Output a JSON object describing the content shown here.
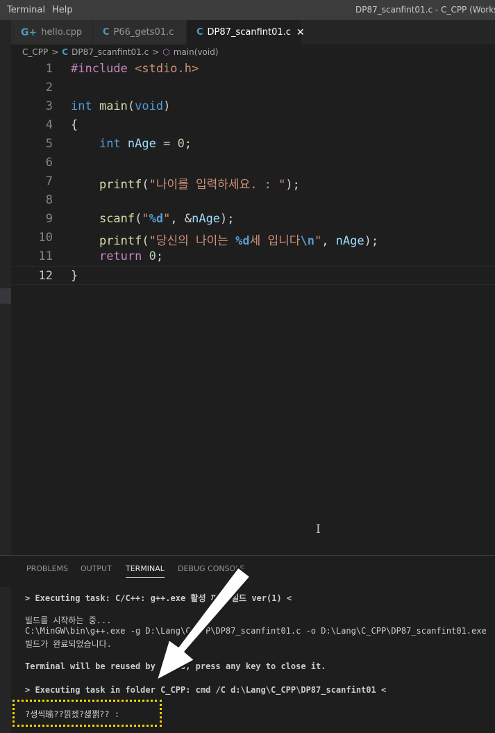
{
  "menu": [
    "Terminal",
    "Help"
  ],
  "window_title": "DP87_scanfint01.c - C_CPP (Workspace",
  "tabs": [
    {
      "label": "hello.cpp",
      "icon": "cpp-file-icon",
      "glyph": "G+"
    },
    {
      "label": "P66_gets01.c",
      "icon": "c-file-icon",
      "glyph": "C"
    },
    {
      "label": "DP87_scanfint01.c",
      "icon": "c-file-icon",
      "glyph": "C",
      "close": "✕"
    }
  ],
  "breadcrumb": {
    "folder": "C_CPP",
    "sep": ">",
    "file_glyph": "C",
    "file": "DP87_scanfint01.c",
    "symbol_glyph": "⬡",
    "symbol": "main(void)"
  },
  "code_lines": [
    {
      "n": "1",
      "html_parts": [
        [
          "kw-pre",
          "#include "
        ],
        [
          "str",
          "<stdio.h>"
        ]
      ]
    },
    {
      "n": "2",
      "html_parts": []
    },
    {
      "n": "3",
      "html_parts": [
        [
          "kw",
          "int "
        ],
        [
          "fn",
          "main"
        ],
        [
          "",
          "("
        ],
        [
          "kw",
          "void"
        ],
        [
          "",
          ")"
        ]
      ]
    },
    {
      "n": "4",
      "html_parts": [
        [
          "",
          "{"
        ]
      ]
    },
    {
      "n": "5",
      "html_parts": [
        [
          "",
          "    "
        ],
        [
          "kw",
          "int "
        ],
        [
          "var",
          "nAge"
        ],
        [
          "",
          " = "
        ],
        [
          "num",
          "0"
        ],
        [
          "",
          ";"
        ]
      ]
    },
    {
      "n": "6",
      "html_parts": []
    },
    {
      "n": "7",
      "html_parts": [
        [
          "",
          "    "
        ],
        [
          "fn",
          "printf"
        ],
        [
          "",
          "("
        ],
        [
          "str",
          "\"나이를 입력하세요. : \""
        ],
        [
          "",
          ");"
        ]
      ]
    },
    {
      "n": "8",
      "html_parts": []
    },
    {
      "n": "9",
      "html_parts": [
        [
          "",
          "    "
        ],
        [
          "fn",
          "scanf"
        ],
        [
          "",
          "("
        ],
        [
          "str",
          "\""
        ],
        [
          "esc",
          "%d"
        ],
        [
          "str",
          "\""
        ],
        [
          "",
          ", &"
        ],
        [
          "var",
          "nAge"
        ],
        [
          "",
          ");"
        ]
      ]
    },
    {
      "n": "10",
      "html_parts": [
        [
          "",
          "    "
        ],
        [
          "fn",
          "printf"
        ],
        [
          "",
          "("
        ],
        [
          "str",
          "\"당신의 나이는 "
        ],
        [
          "esc",
          "%d"
        ],
        [
          "str",
          "세 입니다"
        ],
        [
          "esc",
          "\\n"
        ],
        [
          "str",
          "\""
        ],
        [
          "",
          ", "
        ],
        [
          "var",
          "nAge"
        ],
        [
          "",
          ");"
        ]
      ]
    },
    {
      "n": "11",
      "html_parts": [
        [
          "",
          "    "
        ],
        [
          "ctrl",
          "return "
        ],
        [
          "num",
          "0"
        ],
        [
          "",
          ";"
        ]
      ]
    },
    {
      "n": "12",
      "html_parts": [
        [
          "",
          "}"
        ]
      ]
    }
  ],
  "panel_tabs": [
    "PROBLEMS",
    "OUTPUT",
    "TERMINAL",
    "DEBUG CONSOLE"
  ],
  "terminal": {
    "task1": "> Executing task: C/C++: g++.exe 활성 파일 빌드 ver(1) <",
    "build_start": "빌드를 시작하는 중...",
    "cmd": "C:\\MinGW\\bin\\g++.exe -g D:\\Lang\\C_CPP\\DP87_scanfint01.c -o D:\\Lang\\C_CPP\\DP87_scanfint01.exe",
    "build_done": "빌드가 완료되었습니다.",
    "reuse": "Terminal will be reused by tasks, press any key to close it.",
    "task2": "> Executing task in folder C_CPP: cmd /C d:\\Lang\\C_CPP\\DP87_scanfint01 <",
    "output": "?생씩瑜??낅젰?섏꽭?? :"
  },
  "colors": {
    "highlight_box": "#f5d400",
    "arrow": "#ffffff"
  }
}
